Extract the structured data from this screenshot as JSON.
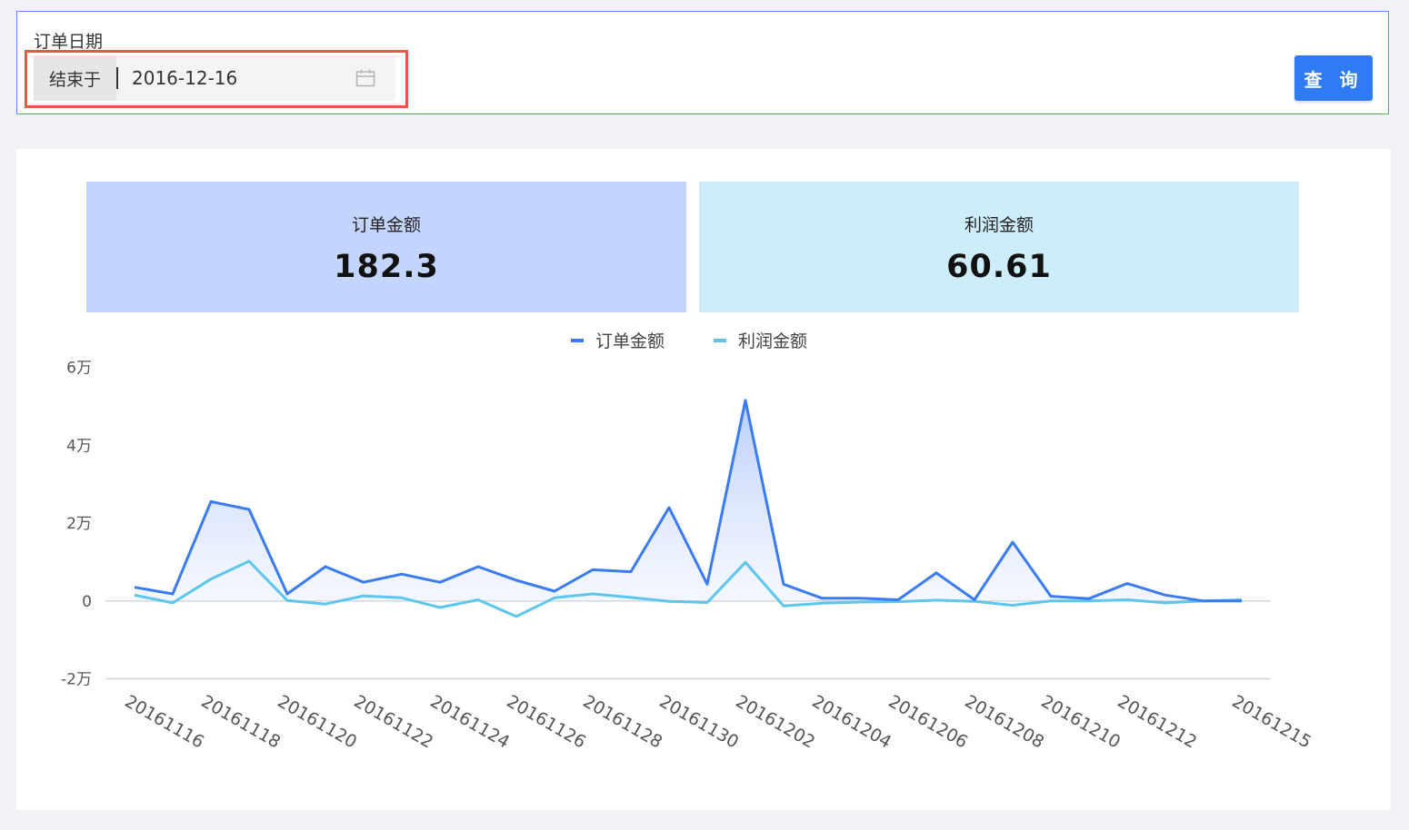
{
  "filter": {
    "label": "订单日期",
    "prefix": "结束于",
    "date_value": "2016-12-16",
    "query_button": "查 询"
  },
  "kpis": [
    {
      "title": "订单金额",
      "value": "182.3"
    },
    {
      "title": "利润金额",
      "value": "60.61"
    }
  ],
  "colors": {
    "accent": "#2f7bf6",
    "order_line": "#3b7bf2",
    "profit_line": "#5dc6ec",
    "highlight": "#e8564a",
    "kpi_order_bg": "#c4d5fd",
    "kpi_profit_bg": "#cdedfb"
  },
  "chart_data": {
    "type": "line",
    "categories": [
      "20161116",
      "20161117",
      "20161118",
      "20161119",
      "20161120",
      "20161121",
      "20161122",
      "20161123",
      "20161124",
      "20161125",
      "20161126",
      "20161127",
      "20161128",
      "20161129",
      "20161130",
      "20161201",
      "20161202",
      "20161203",
      "20161204",
      "20161205",
      "20161206",
      "20161207",
      "20161208",
      "20161209",
      "20161210",
      "20161211",
      "20161212",
      "20161213",
      "20161214",
      "20161215"
    ],
    "tick_labels": [
      "20161116",
      "20161118",
      "20161120",
      "20161122",
      "20161124",
      "20161126",
      "20161128",
      "20161130",
      "20161202",
      "20161204",
      "20161206",
      "20161208",
      "20161210",
      "20161212",
      "20161215"
    ],
    "series": [
      {
        "name": "订单金额",
        "color": "#3b7bf2",
        "area": true,
        "values": [
          3500,
          1800,
          25500,
          23500,
          1800,
          8800,
          4800,
          6900,
          4800,
          8800,
          5300,
          2500,
          8000,
          7500,
          24000,
          4300,
          51500,
          4300,
          700,
          700,
          300,
          7200,
          300,
          15100,
          1200,
          600,
          4500,
          1500,
          0,
          0
        ]
      },
      {
        "name": "利润金额",
        "color": "#5dc6ec",
        "area": false,
        "values": [
          1500,
          -500,
          5600,
          10200,
          100,
          -800,
          1300,
          800,
          -1700,
          300,
          -4000,
          800,
          1800,
          900,
          -100,
          -400,
          9900,
          -1300,
          -600,
          -300,
          -200,
          200,
          -100,
          -1100,
          0,
          0,
          300,
          -500,
          0,
          300
        ]
      }
    ],
    "y_ticks": [
      "6万",
      "4万",
      "2万",
      "0",
      "-2万"
    ],
    "y_tick_values": [
      60000,
      40000,
      20000,
      0,
      -20000
    ],
    "ylim": [
      -20000,
      60000
    ],
    "legend_position": "top-center",
    "grid": false
  }
}
